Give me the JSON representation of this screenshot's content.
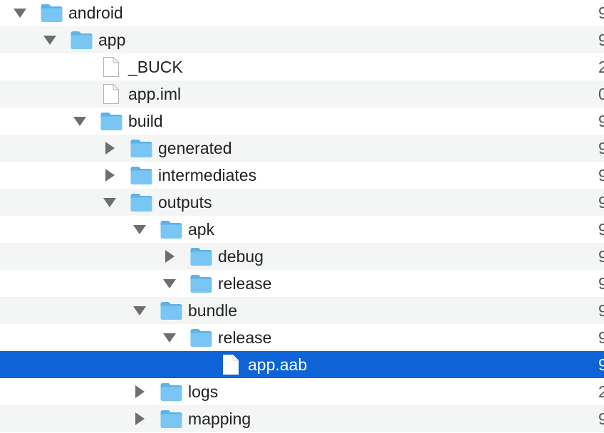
{
  "colors": {
    "selection": "#0e63d7",
    "stripe": "#f4f5f5",
    "folder": "#79c6f4",
    "text": "#222222"
  },
  "rows": [
    {
      "name": "android",
      "depth": 0,
      "kind": "folder",
      "disclosure": "expanded",
      "trail": "9",
      "selected": false
    },
    {
      "name": "app",
      "depth": 1,
      "kind": "folder",
      "disclosure": "expanded",
      "trail": "9",
      "selected": false
    },
    {
      "name": "_BUCK",
      "depth": 2,
      "kind": "file",
      "disclosure": "none",
      "trail": "2",
      "selected": false
    },
    {
      "name": "app.iml",
      "depth": 2,
      "kind": "file",
      "disclosure": "none",
      "trail": "0",
      "selected": false
    },
    {
      "name": "build",
      "depth": 2,
      "kind": "folder",
      "disclosure": "expanded",
      "trail": "9",
      "selected": false
    },
    {
      "name": "generated",
      "depth": 3,
      "kind": "folder",
      "disclosure": "collapsed",
      "trail": "9",
      "selected": false
    },
    {
      "name": "intermediates",
      "depth": 3,
      "kind": "folder",
      "disclosure": "collapsed",
      "trail": "9",
      "selected": false
    },
    {
      "name": "outputs",
      "depth": 3,
      "kind": "folder",
      "disclosure": "expanded",
      "trail": "9",
      "selected": false
    },
    {
      "name": "apk",
      "depth": 4,
      "kind": "folder",
      "disclosure": "expanded",
      "trail": "9",
      "selected": false
    },
    {
      "name": "debug",
      "depth": 5,
      "kind": "folder",
      "disclosure": "collapsed",
      "trail": "9",
      "selected": false
    },
    {
      "name": "release",
      "depth": 5,
      "kind": "folder",
      "disclosure": "expanded",
      "trail": "9",
      "selected": false
    },
    {
      "name": "bundle",
      "depth": 4,
      "kind": "folder",
      "disclosure": "expanded",
      "trail": "9",
      "selected": false
    },
    {
      "name": "release",
      "depth": 5,
      "kind": "folder",
      "disclosure": "expanded",
      "trail": "9",
      "selected": false
    },
    {
      "name": "app.aab",
      "depth": 6,
      "kind": "file",
      "disclosure": "none",
      "trail": "9",
      "selected": true
    },
    {
      "name": "logs",
      "depth": 4,
      "kind": "folder",
      "disclosure": "collapsed",
      "trail": "2",
      "selected": false
    },
    {
      "name": "mapping",
      "depth": 4,
      "kind": "folder",
      "disclosure": "collapsed",
      "trail": "9",
      "selected": false
    }
  ]
}
